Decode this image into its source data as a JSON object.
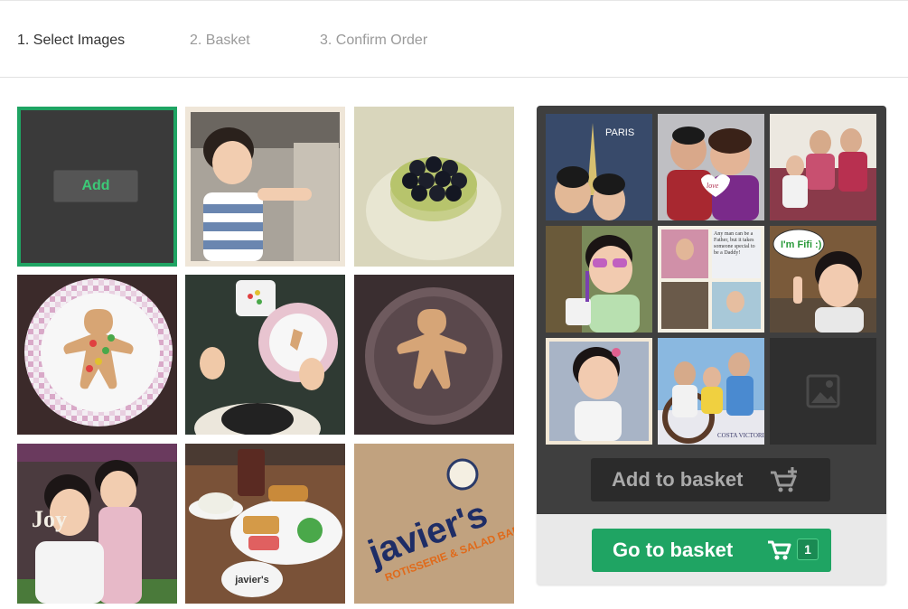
{
  "steps": [
    {
      "label": "1. Select Images",
      "active": true
    },
    {
      "label": "2. Basket",
      "active": false
    },
    {
      "label": "3. Confirm Order",
      "active": false
    }
  ],
  "gallery": {
    "add_label": "Add",
    "photos": [
      {
        "name": "girl-eating-photo"
      },
      {
        "name": "blueberry-tart-photo"
      },
      {
        "name": "gingerbread-plate-photo"
      },
      {
        "name": "child-eating-photo"
      },
      {
        "name": "gingerbread-dark-plate-photo"
      },
      {
        "name": "sisters-photo",
        "caption": "Joy"
      },
      {
        "name": "restaurant-meal-photo",
        "caption": "javier's"
      },
      {
        "name": "javiers-sign-photo",
        "caption": "javier's",
        "subcaption": "ROTISSERIE & SALAD BAR"
      }
    ]
  },
  "selection": {
    "thumbs": [
      {
        "name": "paris-couple-thumb",
        "caption": "PARIS"
      },
      {
        "name": "couple-heart-thumb",
        "caption": "love"
      },
      {
        "name": "family-sofa-thumb"
      },
      {
        "name": "girl-sunglasses-thumb"
      },
      {
        "name": "fathers-day-collage-thumb",
        "caption": "Any man can be a Father, but it takes someone special to be a Daddy!"
      },
      {
        "name": "fifi-thumb",
        "caption": "I'm Fifi :)"
      },
      {
        "name": "girl-portrait-thumb"
      },
      {
        "name": "cruise-family-thumb",
        "caption": "COSTA VICTORIA"
      },
      {
        "name": "empty-slot-thumb"
      }
    ],
    "add_to_basket_label": "Add to basket",
    "go_to_basket_label": "Go to basket",
    "basket_count": "1"
  },
  "colors": {
    "accent": "#1fa463",
    "panel": "#3f3f3f",
    "empty_slot": "#2f2f2f"
  }
}
